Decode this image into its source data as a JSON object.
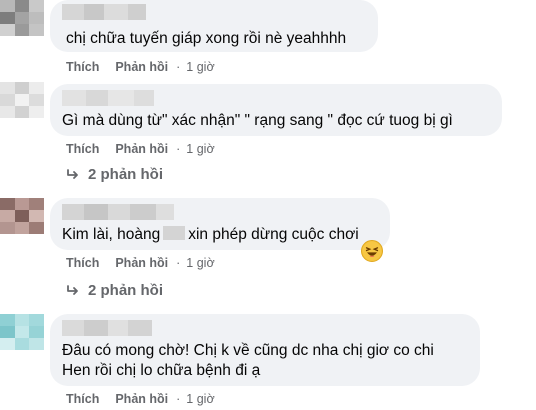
{
  "comments": [
    {
      "text": "chị chữa tuyến giáp xong rồi nè yeahhhh",
      "like": "Thích",
      "reply": "Phản hồi",
      "time": "1 giờ"
    },
    {
      "text": "Gì mà dùng từ\" xác nhận\" \" rạng sang \" đọc cứ tuog bị gì",
      "like": "Thích",
      "reply": "Phản hồi",
      "time": "1 giờ",
      "replies": "2 phản hồi"
    },
    {
      "text_before": "Kim lài, hoàng",
      "text_after": "xin phép dừng cuộc chơi",
      "like": "Thích",
      "reply": "Phản hồi",
      "time": "1 giờ",
      "replies": "2 phản hồi",
      "reaction_icon": "laughing-emoji-icon"
    },
    {
      "line1": "Đâu có mong chờ! Chị k về cũng dc nha chị giơ co chi",
      "line2": "Hen rồi chị lo chữa bệnh đi ạ",
      "like": "Thích",
      "reply": "Phản hồi",
      "time": "1 giờ"
    }
  ],
  "colors": {
    "bubble": "#f0f2f5",
    "text": "#050505",
    "meta": "#65676b"
  }
}
